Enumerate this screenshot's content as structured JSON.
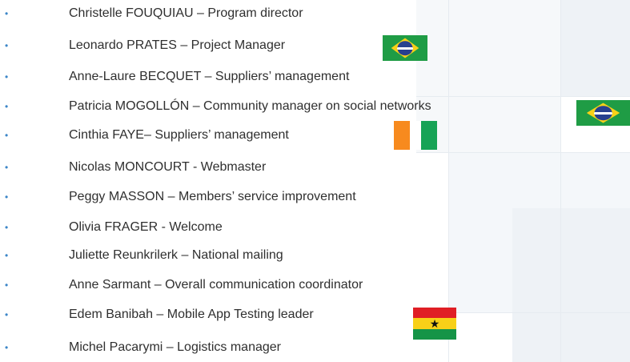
{
  "members": [
    {
      "name": "Christelle FOUQUIAU – Program director",
      "flag": null
    },
    {
      "name": "Leonardo PRATES – Project Manager",
      "flag": "brazil"
    },
    {
      "name": "Anne-Laure BECQUET – Suppliers’ management",
      "flag": null
    },
    {
      "name": "Patricia MOGOLLÓN – Community manager on social networks",
      "flag": "brazil"
    },
    {
      "name": "Cinthia FAYE– Suppliers’ management",
      "flag": "cote-d-ivoire"
    },
    {
      "name": "Nicolas MONCOURT - Webmaster",
      "flag": null
    },
    {
      "name": "Peggy MASSON – Members’ service improvement",
      "flag": null
    },
    {
      "name": "Olivia FRAGER - Welcome",
      "flag": null
    },
    {
      "name": "Juliette Reunkrilerk – National mailing",
      "flag": null
    },
    {
      "name": "Anne Sarmant – Overall communication coordinator",
      "flag": null
    },
    {
      "name": "Edem Banibah – Mobile App Testing leader",
      "flag": "ghana"
    },
    {
      "name": "Michel Pacarymi – Logistics manager",
      "flag": null
    }
  ],
  "bullet_symbol": "•",
  "colors": {
    "bullet": "#3c86c8",
    "text": "#2f2f2f"
  }
}
